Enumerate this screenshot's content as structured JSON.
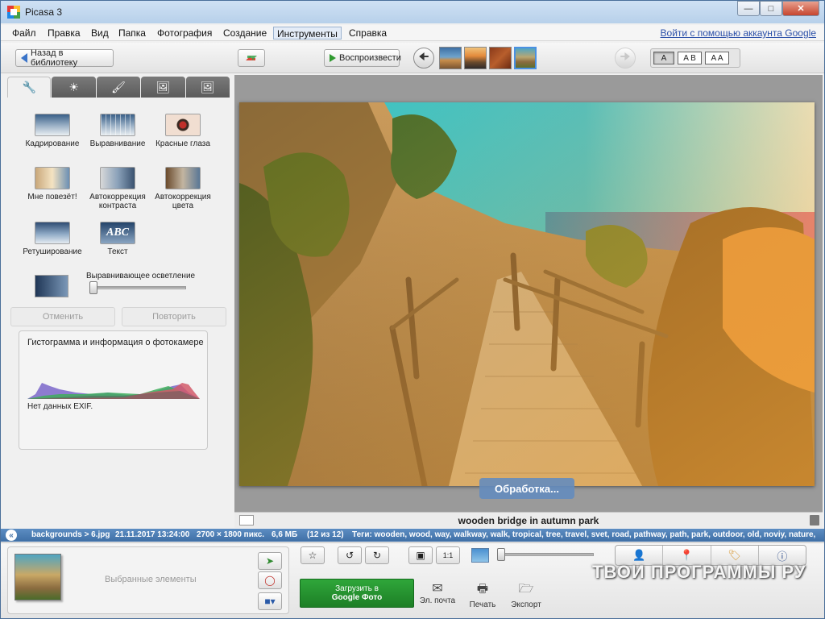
{
  "window": {
    "title": "Picasa 3"
  },
  "menu": {
    "items": [
      "Файл",
      "Правка",
      "Вид",
      "Папка",
      "Фотография",
      "Создание",
      "Инструменты",
      "Справка"
    ],
    "active": "Инструменты",
    "signin": "Войти с помощью аккаунта Google"
  },
  "toolbar": {
    "back_label": "Назад в библиотеку",
    "play_label": "Воспроизвести",
    "caption_options": [
      "A",
      "A B",
      "A A"
    ]
  },
  "tools": {
    "crop": "Кадрирование",
    "straighten": "Выравнивание",
    "redeye": "Красные глаза",
    "lucky": "Мне повезёт!",
    "auto_contrast": "Автокоррекция контраста",
    "auto_color": "Автокоррекция цвета",
    "retouch": "Ретуширование",
    "text": "Текст",
    "text_icon": "ABC",
    "fill_light": "Выравнивающее осветление",
    "undo": "Отменить",
    "redo": "Повторить"
  },
  "histogram": {
    "title": "Гистограмма и информация о фотокамере",
    "exif": "Нет данных EXIF."
  },
  "photo": {
    "processing": "Обработка...",
    "caption": "wooden bridge in autumn park"
  },
  "status": {
    "path": "backgrounds > 6.jpg",
    "datetime": "21.11.2017 13:24:00",
    "dimensions": "2700 × 1800 пикс.",
    "size": "6,6 МБ",
    "position": "(12 из 12)",
    "tags": "Теги: wooden, wood, way, walkway, walk, tropical, tree, travel, svet, road, pathway, path, park, outdoor, old, noviy, nature,"
  },
  "tray": {
    "label": "Выбранные элементы",
    "upload_line1": "Загрузить в",
    "upload_line2": "Google Фото",
    "email": "Эл. почта",
    "print": "Печать",
    "export": "Экспорт"
  },
  "watermark": "ТВОИ ПРОГРАММЫ РУ"
}
